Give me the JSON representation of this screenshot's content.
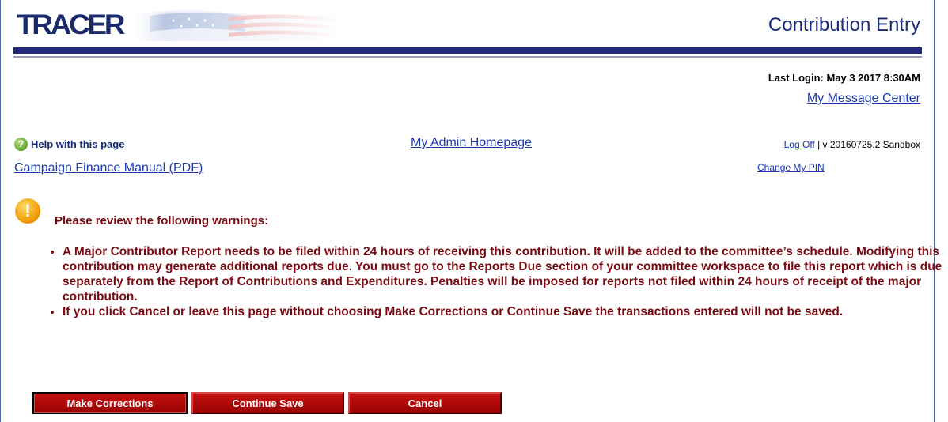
{
  "header": {
    "logo_text": "TRACER",
    "page_title": "Contribution Entry",
    "last_login": "Last Login: May 3 2017 8:30AM",
    "message_center": "My Message Center"
  },
  "nav": {
    "help": "Help with this page",
    "manual": "Campaign Finance Manual (PDF)",
    "admin_home": "My Admin Homepage",
    "log_off": "Log Off",
    "version": " | v 20160725.2 Sandbox",
    "change_pin": "Change My PIN"
  },
  "warnings": {
    "heading": "Please review the following warnings:",
    "items": [
      "A Major Contributor Report needs to be filed within 24 hours of receiving this contribution. It will be added to the committee’s schedule. Modifying this contribution may generate additional reports due. You must go to the Reports Due section of your committee workspace to file this report which is due separately from the Report of Contributions and Expenditures. Penalties will be imposed for reports not filed within 24 hours of receipt of the major contribution.",
      "If you click Cancel or leave this page without choosing Make Corrections or Continue Save the transactions entered will not be saved."
    ]
  },
  "buttons": {
    "make_corrections": "Make Corrections",
    "continue_save": "Continue Save",
    "cancel": "Cancel"
  },
  "colors": {
    "header_bar": "#232a7a",
    "link": "#1b39b0",
    "warning_text": "#7b0b12",
    "button": "#b00000"
  },
  "icons": {
    "help": "help-question-icon",
    "warning": "exclamation-warning-icon"
  }
}
